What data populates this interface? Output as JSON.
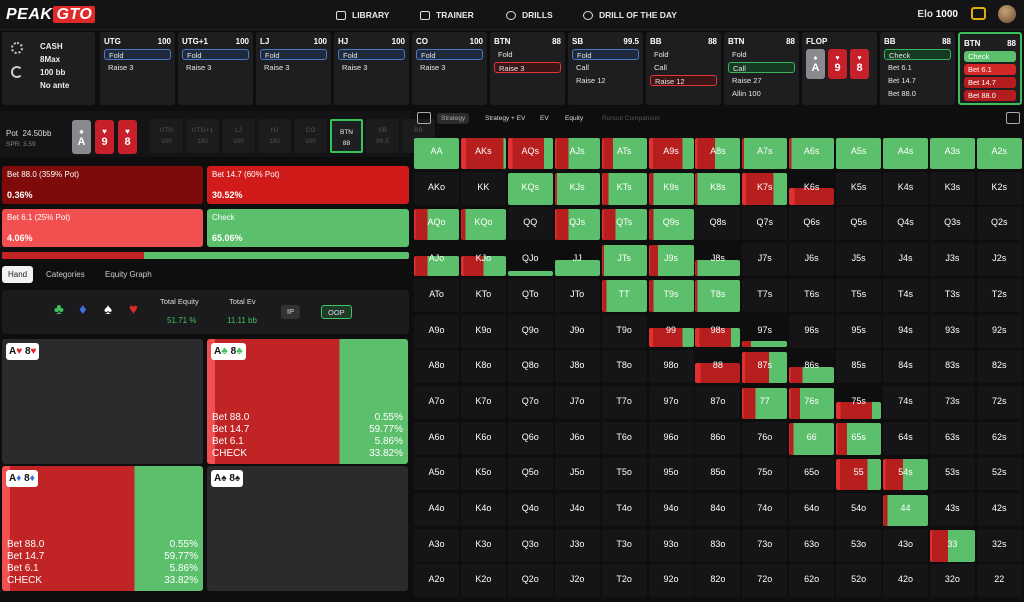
{
  "brand": {
    "logo_left": "PEAK",
    "logo_right": "GTO"
  },
  "nav": [
    {
      "label": "LIBRARY",
      "icon": "book-icon"
    },
    {
      "label": "TRAINER",
      "icon": "gamepad-icon"
    },
    {
      "label": "DRILLS",
      "icon": "target-icon"
    },
    {
      "label": "DRILL OF THE DAY",
      "icon": "clock-icon"
    }
  ],
  "elo": {
    "label": "Elo",
    "value": "1000"
  },
  "game": {
    "type": "CASH",
    "max": "8Max",
    "stack": "100 bb",
    "ante": "No ante"
  },
  "positions": [
    {
      "name": "UTG",
      "stack": "100",
      "actions": [
        {
          "label": "Fold",
          "style": "sel-blue"
        },
        {
          "label": "Raise 3",
          "style": ""
        }
      ]
    },
    {
      "name": "UTG+1",
      "stack": "100",
      "actions": [
        {
          "label": "Fold",
          "style": "sel-blue"
        },
        {
          "label": "Raise 3",
          "style": ""
        }
      ]
    },
    {
      "name": "LJ",
      "stack": "100",
      "actions": [
        {
          "label": "Fold",
          "style": "sel-blue"
        },
        {
          "label": "Raise 3",
          "style": ""
        }
      ]
    },
    {
      "name": "HJ",
      "stack": "100",
      "actions": [
        {
          "label": "Fold",
          "style": "sel-blue"
        },
        {
          "label": "Raise 3",
          "style": ""
        }
      ]
    },
    {
      "name": "CO",
      "stack": "100",
      "actions": [
        {
          "label": "Fold",
          "style": "sel-blue"
        },
        {
          "label": "Raise 3",
          "style": ""
        }
      ]
    },
    {
      "name": "BTN",
      "stack": "88",
      "actions": [
        {
          "label": "Fold",
          "style": ""
        },
        {
          "label": "Raise 3",
          "style": "sel-red"
        }
      ]
    },
    {
      "name": "SB",
      "stack": "99.5",
      "actions": [
        {
          "label": "Fold",
          "style": "sel-blue"
        },
        {
          "label": "Call",
          "style": ""
        },
        {
          "label": "Raise 12",
          "style": ""
        }
      ]
    },
    {
      "name": "BB",
      "stack": "88",
      "actions": [
        {
          "label": "Fold",
          "style": ""
        },
        {
          "label": "Call",
          "style": ""
        },
        {
          "label": "Raise 12",
          "style": "sel-red"
        }
      ]
    },
    {
      "name": "BTN",
      "stack": "88",
      "actions": [
        {
          "label": "Fold",
          "style": ""
        },
        {
          "label": "Call",
          "style": "sel-green"
        },
        {
          "label": "Raise 27",
          "style": ""
        },
        {
          "label": "Allin 100",
          "style": ""
        }
      ]
    },
    {
      "name": "FLOP",
      "stack": "",
      "cards": [
        {
          "rank": "A",
          "suit": "♠",
          "color": "grey"
        },
        {
          "rank": "9",
          "suit": "♥",
          "color": "red"
        },
        {
          "rank": "8",
          "suit": "♥",
          "color": "red"
        }
      ]
    },
    {
      "name": "BB",
      "stack": "88",
      "actions": [
        {
          "label": "Check",
          "style": "sel-green"
        },
        {
          "label": "Bet 6.1",
          "style": ""
        },
        {
          "label": "Bet 14.7",
          "style": ""
        },
        {
          "label": "Bet 88.0",
          "style": ""
        }
      ]
    },
    {
      "name": "BTN",
      "stack": "88",
      "active": true,
      "actions": [
        {
          "label": "Check",
          "style": "fill-green"
        },
        {
          "label": "Bet 6.1",
          "style": "fill-red"
        },
        {
          "label": "Bet 14.7",
          "style": "fill-red2"
        },
        {
          "label": "Bet 88.0",
          "style": "fill-red2"
        }
      ]
    }
  ],
  "pot": {
    "label": "Pot",
    "value": "24.50bb",
    "spr": "SPR: 3.59"
  },
  "board": [
    {
      "rank": "A",
      "suit": "♠",
      "color": "grey"
    },
    {
      "rank": "9",
      "suit": "♥",
      "color": "red"
    },
    {
      "rank": "8",
      "suit": "♥",
      "color": "red"
    }
  ],
  "seats": [
    {
      "name": "UTG",
      "stack": "100"
    },
    {
      "name": "UTG+1",
      "stack": "100"
    },
    {
      "name": "LJ",
      "stack": "100"
    },
    {
      "name": "HJ",
      "stack": "100"
    },
    {
      "name": "CO",
      "stack": "100"
    },
    {
      "name": "BTN",
      "stack": "88",
      "hl": true
    },
    {
      "name": "SB",
      "stack": "99.5"
    },
    {
      "name": "BB",
      "stack": "88"
    }
  ],
  "strategy": [
    {
      "label": "Bet 88.0 (359% Pot)",
      "value": "0.36%",
      "color": "#7e0a0a"
    },
    {
      "label": "Bet 14.7 (60% Pot)",
      "value": "30.52%",
      "color": "#d11b1b"
    },
    {
      "label": "Bet 6.1 (25% Pot)",
      "value": "4.06%",
      "color": "#f25050"
    },
    {
      "label": "Check",
      "value": "65.06%",
      "color": "#5bbf6b"
    }
  ],
  "overall_bar": {
    "bet": 0.35,
    "check": 0.65
  },
  "tabs": [
    "Hand",
    "Categories",
    "Equity Graph"
  ],
  "equity": {
    "total_equity_label": "Total Equity",
    "total_equity": "51.71 %",
    "total_ev_label": "Total Ev",
    "total_ev": "11.11 bb",
    "ip": "IP",
    "oop": "OOP"
  },
  "suits": [
    {
      "sym": "♣",
      "color": "#3fc25f"
    },
    {
      "sym": "♦",
      "color": "#3d6fe0"
    },
    {
      "sym": "♠",
      "color": "#ffffff"
    },
    {
      "sym": "♥",
      "color": "#e02a2a"
    }
  ],
  "combos": [
    {
      "r1": "A",
      "s1": "♥",
      "c1": "#e02a2a",
      "r2": "8",
      "s2": "♥",
      "c2": "#e02a2a",
      "lines": []
    },
    {
      "r1": "A",
      "s1": "♣",
      "c1": "#3fc25f",
      "r2": "8",
      "s2": "♣",
      "c2": "#3fc25f",
      "red": 0.66,
      "lines": [
        {
          "k": "Bet 88.0",
          "v": "0.55%"
        },
        {
          "k": "Bet 14.7",
          "v": "59.77%"
        },
        {
          "k": "Bet 6.1",
          "v": "5.86%"
        },
        {
          "k": "CHECK",
          "v": "33.82%"
        }
      ]
    },
    {
      "r1": "A",
      "s1": "♦",
      "c1": "#3d6fe0",
      "r2": "8",
      "s2": "♦",
      "c2": "#3d6fe0",
      "red": 0.66,
      "lines": [
        {
          "k": "Bet 88.0",
          "v": "0.55%"
        },
        {
          "k": "Bet 14.7",
          "v": "59.77%"
        },
        {
          "k": "Bet 6.1",
          "v": "5.86%"
        },
        {
          "k": "CHECK",
          "v": "33.82%"
        }
      ]
    },
    {
      "r1": "A",
      "s1": "♠",
      "c1": "#222222",
      "r2": "8",
      "s2": "♠",
      "c2": "#222222",
      "lines": []
    }
  ],
  "right_tabs": [
    "Strategy",
    "Strategy + EV",
    "EV",
    "Equity",
    "Runout Comparison"
  ],
  "ranks": [
    "A",
    "K",
    "Q",
    "J",
    "T",
    "9",
    "8",
    "7",
    "6",
    "5",
    "4",
    "3",
    "2"
  ],
  "cells": {
    "AA": {
      "f": 0.95,
      "r": 0.0
    },
    "AKs": {
      "f": 0.95,
      "r": 0.95
    },
    "AQs": {
      "f": 0.95,
      "r": 0.8
    },
    "AJs": {
      "f": 0.95,
      "r": 0.3
    },
    "ATs": {
      "f": 0.95,
      "r": 0.25
    },
    "A9s": {
      "f": 0.95,
      "r": 0.75
    },
    "A8s": {
      "f": 0.95,
      "r": 0.45
    },
    "A7s": {
      "f": 0.95,
      "r": 0.05
    },
    "A6s": {
      "f": 0.95,
      "r": 0.05
    },
    "A5s": {
      "f": 0.95,
      "r": 0.0
    },
    "A4s": {
      "f": 0.95,
      "r": 0.0
    },
    "A3s": {
      "f": 0.95,
      "r": 0.0
    },
    "A2s": {
      "f": 0.95,
      "r": 0.0
    },
    "KQs": {
      "f": 0.95,
      "r": 0.0
    },
    "KJs": {
      "f": 0.95,
      "r": 0.05
    },
    "KTs": {
      "f": 0.95,
      "r": 0.15
    },
    "K9s": {
      "f": 0.95,
      "r": 0.1
    },
    "K8s": {
      "f": 0.95,
      "r": 0.05
    },
    "K7s": {
      "f": 0.95,
      "r": 0.7
    },
    "K6s": {
      "f": 0.5,
      "r": 1.0
    },
    "AQo": {
      "f": 0.95,
      "r": 0.3
    },
    "KQo": {
      "f": 0.95,
      "r": 0.1
    },
    "QJs": {
      "f": 0.95,
      "r": 0.3
    },
    "QTs": {
      "f": 0.95,
      "r": 0.3
    },
    "Q9s": {
      "f": 0.95,
      "r": 0.1
    },
    "AJo": {
      "f": 0.6,
      "r": 0.3
    },
    "KJo": {
      "f": 0.6,
      "r": 0.5
    },
    "QJo": {
      "f": 0.15,
      "r": 0.0
    },
    "JJ": {
      "f": 0.5,
      "r": 0.0
    },
    "JTs": {
      "f": 0.95,
      "r": 0.05
    },
    "J9s": {
      "f": 0.95,
      "r": 0.2
    },
    "J8s": {
      "f": 0.5,
      "r": 0.05
    },
    "TT": {
      "f": 0.95,
      "r": 0.1
    },
    "T9s": {
      "f": 0.95,
      "r": 0.1
    },
    "T8s": {
      "f": 0.95,
      "r": 0.05
    },
    "99": {
      "f": 0.6,
      "r": 0.75
    },
    "98s": {
      "f": 0.6,
      "r": 0.8
    },
    "97s": {
      "f": 0.2,
      "r": 0.2
    },
    "88": {
      "f": 0.6,
      "r": 1.0
    },
    "87s": {
      "f": 0.95,
      "r": 0.6
    },
    "86s": {
      "f": 0.5,
      "r": 0.3
    },
    "77": {
      "f": 0.95,
      "r": 0.3
    },
    "76s": {
      "f": 0.95,
      "r": 0.25
    },
    "75s": {
      "f": 0.5,
      "r": 0.8
    },
    "66": {
      "f": 0.95,
      "r": 0.1
    },
    "65s": {
      "f": 0.95,
      "r": 0.25
    },
    "55": {
      "f": 0.95,
      "r": 0.7
    },
    "54s": {
      "f": 0.95,
      "r": 0.45
    },
    "44": {
      "f": 0.95,
      "r": 0.1
    },
    "33": {
      "f": 0.95,
      "r": 0.4
    }
  }
}
